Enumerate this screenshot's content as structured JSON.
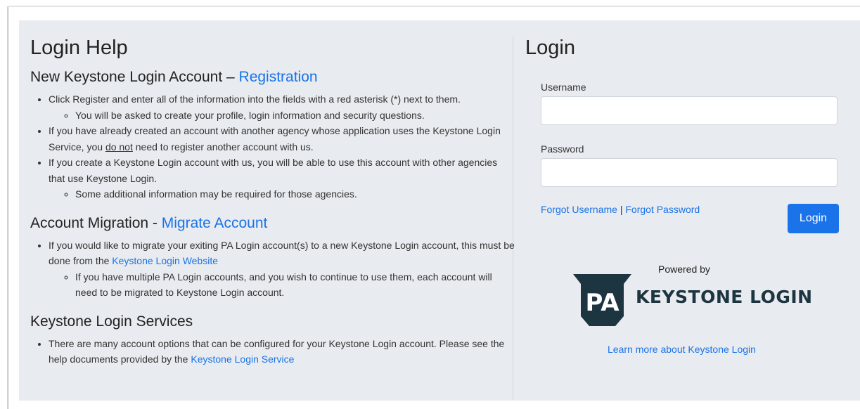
{
  "help": {
    "title": "Login Help",
    "registration": {
      "heading": "New Keystone Login Account – ",
      "link": "Registration",
      "b1": "Click Register and enter all of the information into the fields with a red asterisk (*) next to them.",
      "b1_sub": "You will be asked to create your profile, login information and security questions.",
      "b2_pre": "If you have already created an account with another agency whose application uses the Keystone Login Service, you ",
      "b2_emph": "do not",
      "b2_post": " need to register another account with us.",
      "b3": "If you create a Keystone Login account with us, you will be able to use this account with other agencies that use Keystone Login.",
      "b3_sub": "Some additional information may be required for those agencies."
    },
    "migration": {
      "heading": "Account Migration - ",
      "link": "Migrate Account",
      "b1_pre": "If you would like to migrate your exiting PA Login account(s) to a new Keystone Login account, this must be done from the ",
      "b1_link": "Keystone Login Website",
      "b1_sub": "If you have multiple PA Login accounts, and you wish to continue to use them, each account will need to be migrated to Keystone Login account."
    },
    "services": {
      "heading": "Keystone Login Services",
      "b1_pre": "There are many account options that can be configured for your Keystone Login account. Please see the help documents provided by the ",
      "b1_link": "Keystone Login Service"
    }
  },
  "login": {
    "title": "Login",
    "username_label": "Username",
    "username_value": "",
    "password_label": "Password",
    "password_value": "",
    "forgot_username": "Forgot Username",
    "separator": "|",
    "forgot_password": "Forgot Password",
    "login_button": "Login",
    "powered_by": "Powered by",
    "logo_badge": "PA",
    "logo_text": "KEYSTONE LOGIN",
    "learn_more": "Learn more about Keystone Login"
  },
  "colors": {
    "accent": "#1a73e8",
    "panel": "#e8ebef",
    "logo": "#1d3540"
  }
}
